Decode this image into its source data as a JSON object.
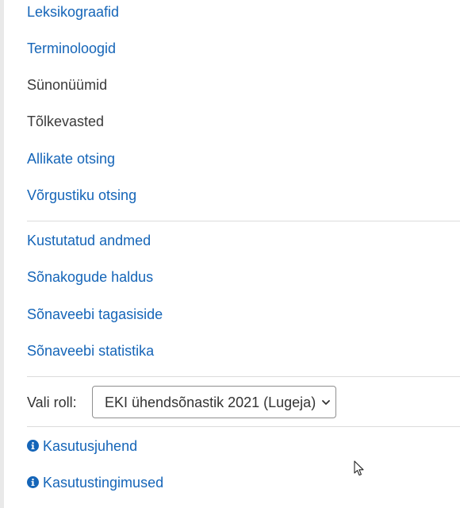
{
  "menu": {
    "group1": [
      {
        "label": "Leksikograafid",
        "enabled": true
      },
      {
        "label": "Terminoloogid",
        "enabled": true
      },
      {
        "label": "Sünonüümid",
        "enabled": false
      },
      {
        "label": "Tõlkevasted",
        "enabled": false
      },
      {
        "label": "Allikate otsing",
        "enabled": true
      },
      {
        "label": "Võrgustiku otsing",
        "enabled": true
      }
    ],
    "group2": [
      {
        "label": "Kustutatud andmed",
        "enabled": true
      },
      {
        "label": "Sõnakogude haldus",
        "enabled": true
      },
      {
        "label": "Sõnaveebi tagasiside",
        "enabled": true
      },
      {
        "label": "Sõnaveebi statistika",
        "enabled": true
      }
    ]
  },
  "role": {
    "label": "Vali roll:",
    "selected": "EKI ühendsõnastik 2021 (Lugeja)"
  },
  "help": {
    "manual": "Kasutusjuhend",
    "terms": "Kasutustingimused",
    "icon": "info-circle-icon"
  },
  "colors": {
    "link": "#1565b8",
    "disabled": "#3a3a3a",
    "divider": "#dcdcdc",
    "sidebar_edge": "#e9e9e9"
  }
}
